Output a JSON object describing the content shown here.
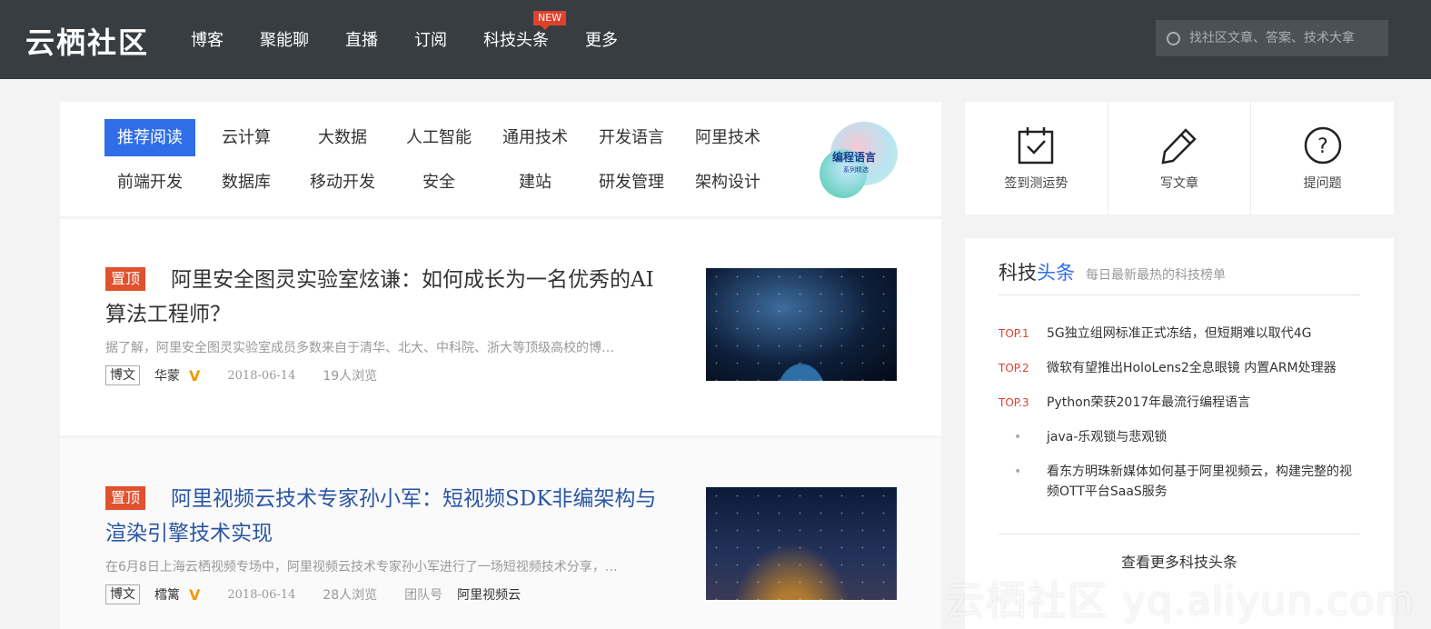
{
  "header": {
    "logo": "云栖社区",
    "nav": [
      "博客",
      "聚能聊",
      "直播",
      "订阅",
      "科技头条",
      "更多"
    ],
    "new_badge": "NEW",
    "search_placeholder": "找社区文章、答案、技术大拿"
  },
  "categories": {
    "row1": [
      "推荐阅读",
      "云计算",
      "大数据",
      "人工智能",
      "通用技术",
      "开发语言",
      "阿里技术"
    ],
    "row2": [
      "前端开发",
      "数据库",
      "移动开发",
      "安全",
      "建站",
      "研发管理",
      "架构设计"
    ],
    "promo_title": "编程语言",
    "promo_sub": "系列精选"
  },
  "articles": [
    {
      "pin": "置顶",
      "title": "阿里安全图灵实验室炫谦：如何成长为一名优秀的AI算法工程师？",
      "summary": "据了解，阿里安全图灵实验室成员多数来自于清华、北大、中科院、浙大等顶级高校的博…",
      "tag": "博文",
      "author": "华蒙",
      "date": "2018-06-14",
      "views": "19人浏览"
    },
    {
      "pin": "置顶",
      "title": "阿里视频云技术专家孙小军：短视频SDK非编架构与渲染引擎技术实现",
      "summary": "在6月8日上海云栖视频专场中，阿里视频云技术专家孙小军进行了一场短视频技术分享，…",
      "tag": "博文",
      "author": "樰篱",
      "date": "2018-06-14",
      "views": "28人浏览",
      "team_label": "团队号",
      "team": "阿里视频云"
    }
  ],
  "actions": [
    "签到测运势",
    "写文章",
    "提问题"
  ],
  "headlines": {
    "title_a": "科技",
    "title_b": "头条",
    "subtitle": "每日最新最热的科技榜单",
    "items": [
      {
        "rank": "TOP.1",
        "text": "5G独立组网标准正式冻结，但短期难以取代4G"
      },
      {
        "rank": "TOP.2",
        "text": "微软有望推出HoloLens2全息眼镜 内置ARM处理器"
      },
      {
        "rank": "TOP.3",
        "text": "Python荣获2017年最流行编程语言"
      },
      {
        "rank": "•",
        "text": "java-乐观锁与悲观锁"
      },
      {
        "rank": "•",
        "text": "看东方明珠新媒体如何基于阿里视频云，构建完整的视频OTT平台SaaS服务"
      }
    ],
    "more": "查看更多科技头条"
  },
  "watermark": "云栖社区 yq.aliyun.com",
  "colors": {
    "topbar": "#373d41",
    "accent": "#2f6ee8",
    "pin": "#e0512d",
    "rank": "#e0412d"
  }
}
